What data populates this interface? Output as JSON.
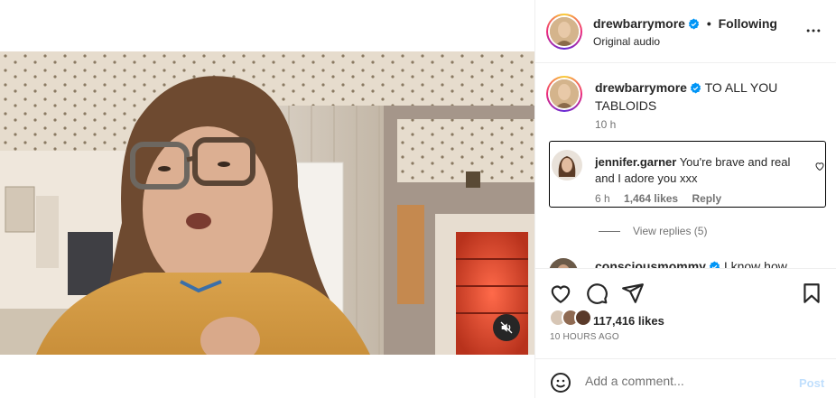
{
  "post": {
    "username": "drewbarrymore",
    "follow_label": "Following",
    "separator": "•",
    "audio_label": "Original audio"
  },
  "caption": {
    "username": "drewbarrymore",
    "text": "TO ALL YOU TABLOIDS",
    "time": "10 h"
  },
  "comments": [
    {
      "username": "jennifer.garner",
      "text": "You're brave and real and I adore you xxx",
      "time": "6 h",
      "likes": "1,464 likes",
      "reply_label": "Reply",
      "view_replies": "View replies (5)"
    },
    {
      "username": "consciousmommy",
      "text": "I know how"
    }
  ],
  "engagement": {
    "likes_count": "117,416 likes",
    "time_ago": "10 HOURS AGO"
  },
  "composer": {
    "placeholder": "Add a comment...",
    "post_label": "Post"
  },
  "colors": {
    "verified": "#0095f6",
    "post_disabled": "#c0dffd",
    "secondary_text": "#737373"
  },
  "icons": {
    "more": "more-horizontal-icon",
    "like": "heart-icon",
    "comment": "comment-icon",
    "share": "share-icon",
    "save": "bookmark-icon",
    "mute": "muted-speaker-icon",
    "emoji": "emoji-icon"
  }
}
